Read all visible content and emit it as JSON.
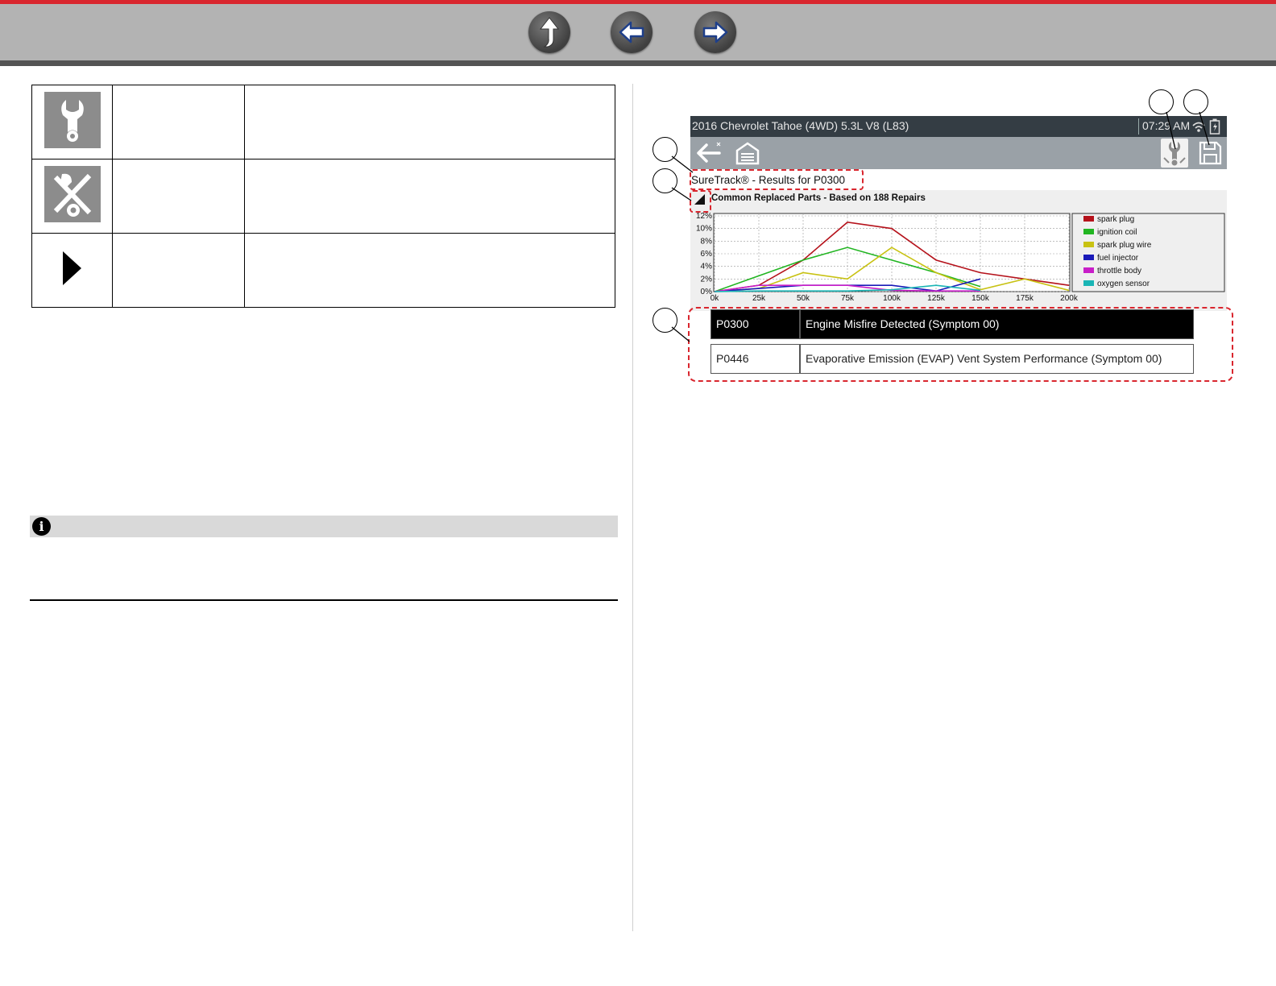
{
  "nav": {
    "buttons": [
      {
        "name": "up-button",
        "icon": "arrow-up-icon"
      },
      {
        "name": "back-button",
        "icon": "arrow-left-icon"
      },
      {
        "name": "forward-button",
        "icon": "arrow-right-icon"
      }
    ]
  },
  "icon_table": {
    "rows": [
      {
        "icon": "wrench-icon",
        "label": "",
        "description": ""
      },
      {
        "icon": "tools-crossed-icon",
        "label": "",
        "description": ""
      },
      {
        "icon": "play-triangle-icon",
        "label": "",
        "description": ""
      }
    ]
  },
  "note": {
    "icon": "info-icon",
    "icon_glyph": "i",
    "text": ""
  },
  "screen": {
    "vehicle": "2016 Chevrolet Tahoe (4WD) 5.3L V8 (L83)",
    "time": "07:29 AM",
    "status_icons": [
      "wifi-icon",
      "battery-icon"
    ],
    "toolbar_icons": [
      "back-arrow-icon",
      "home-icon",
      "suretrack-icon",
      "save-icon"
    ],
    "results_title": "SureTrack® - Results for P0300",
    "chart_header": "Common Replaced Parts - Based on 188 Repairs",
    "dtc_rows": [
      {
        "code": "P0300",
        "description": "Engine Misfire Detected (Symptom 00)",
        "selected": true
      },
      {
        "code": "P0446",
        "description": "Evaporative Emission (EVAP) Vent System Performance (Symptom 00)",
        "selected": false
      }
    ]
  },
  "chart_data": {
    "type": "line",
    "title": "Common Replaced Parts - Based on 188 Repairs",
    "xlabel": "",
    "ylabel": "",
    "categories": [
      "0k",
      "25k",
      "50k",
      "75k",
      "100k",
      "125k",
      "150k",
      "175k",
      "200k"
    ],
    "y_ticks": [
      "0%",
      "2%",
      "4%",
      "6%",
      "8%",
      "10%",
      "12%"
    ],
    "ylim": [
      0,
      12
    ],
    "grid": true,
    "legend_position": "right",
    "series": [
      {
        "name": "spark plug",
        "color": "#b5121b",
        "values": [
          0,
          1,
          5,
          11,
          10,
          5,
          3,
          2,
          1
        ]
      },
      {
        "name": "ignition coil",
        "color": "#21b521",
        "values": [
          0,
          2.5,
          5,
          7,
          5,
          3,
          0.8,
          null,
          null
        ]
      },
      {
        "name": "spark plug wire",
        "color": "#c8c213",
        "values": [
          0,
          0.5,
          3,
          2,
          7,
          3,
          0.3,
          2,
          0.2
        ]
      },
      {
        "name": "fuel injector",
        "color": "#1a1ab8",
        "values": [
          0,
          0.5,
          1,
          1,
          1,
          0.1,
          2,
          null,
          null
        ]
      },
      {
        "name": "throttle body",
        "color": "#c81ec8",
        "values": [
          0,
          1,
          1,
          1,
          0.2,
          0.1,
          0.1,
          null,
          null
        ]
      },
      {
        "name": "oxygen sensor",
        "color": "#1ab5b5",
        "values": [
          0,
          0.1,
          0.1,
          0.1,
          0.3,
          1,
          0.2,
          null,
          null
        ]
      }
    ]
  }
}
